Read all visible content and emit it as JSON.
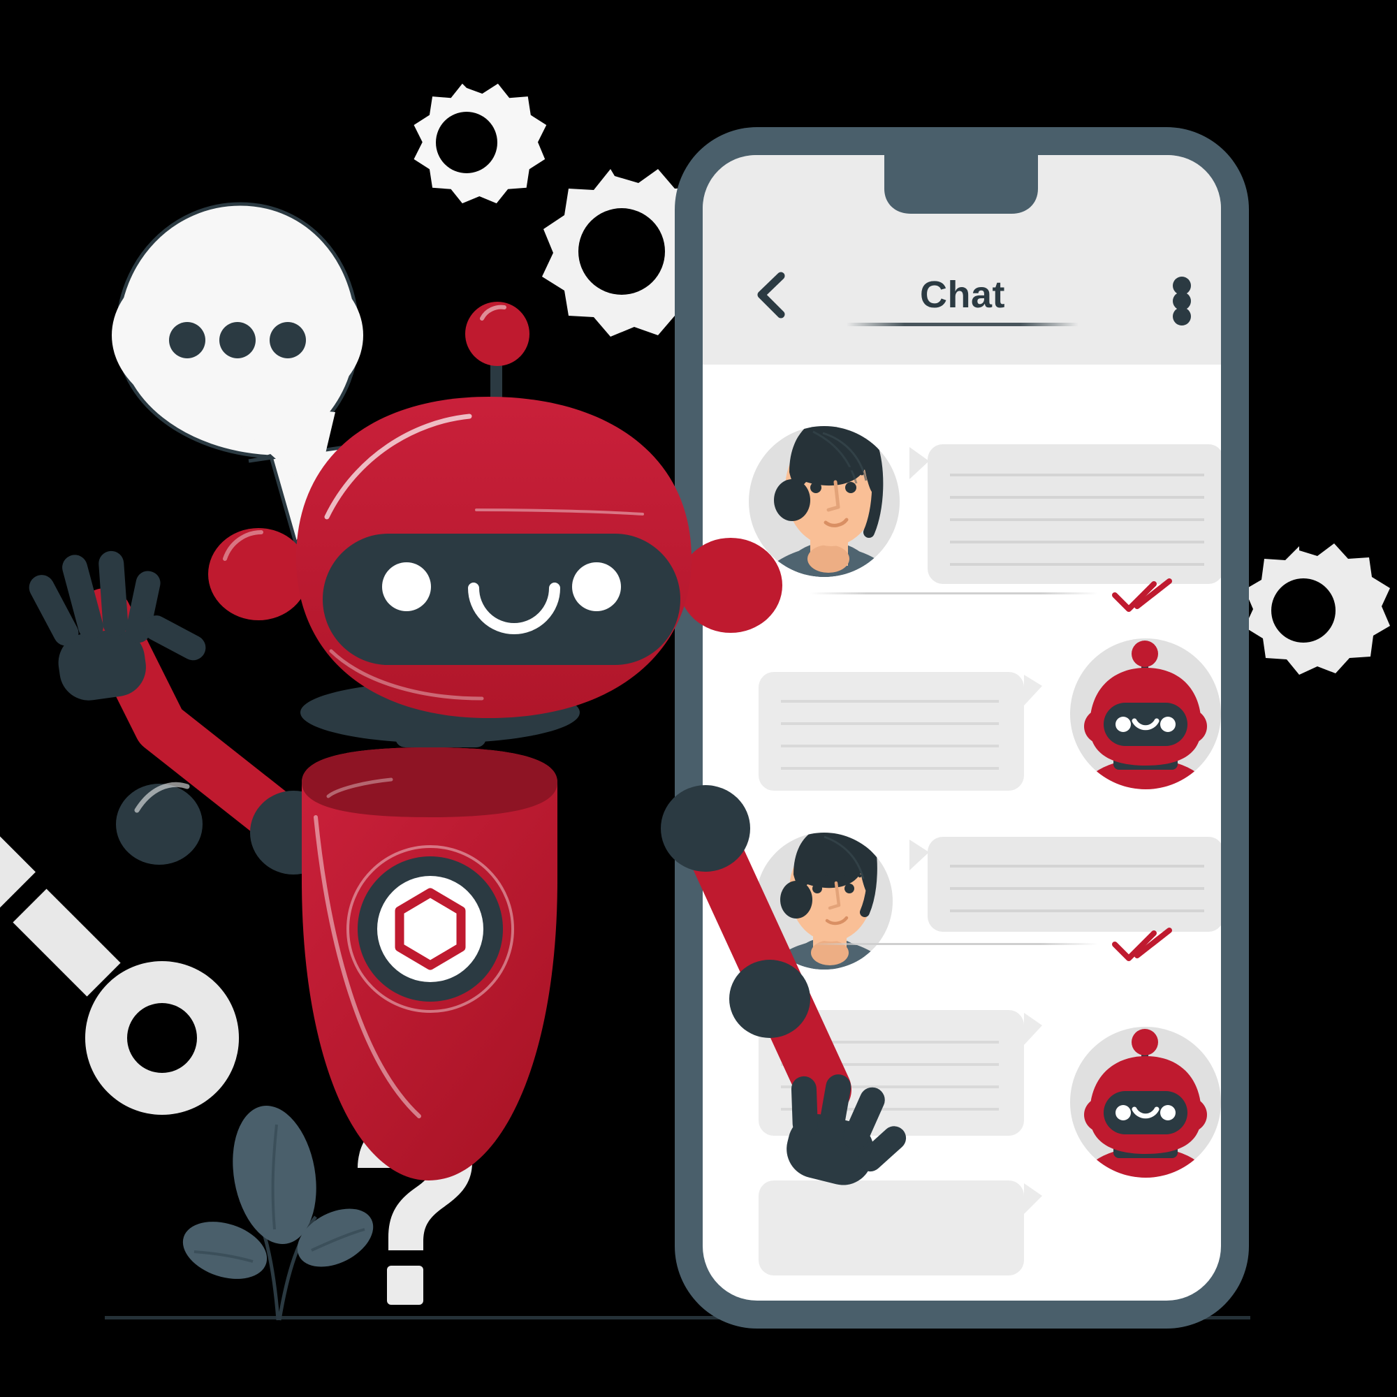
{
  "scene": {
    "title": "Chatbot illustration",
    "background_color": "#000000",
    "palette": {
      "red": "#bf1a2f",
      "red_dark": "#8e1424",
      "red_light": "#c9203a",
      "slate": "#2b3a42",
      "slate_mid": "#4a5f6b",
      "grey_light": "#ebebeb",
      "grey_bubble": "#e8e8e8",
      "grey_line": "#dddddd",
      "white": "#ffffff",
      "off_white": "#f7f7f7",
      "skin": "#f9bf96",
      "hair": "#263238",
      "shirt": "#4f6470",
      "accent_check": "#bf1a2f"
    }
  },
  "phone": {
    "frame_color": "#4a5f6b",
    "screen_color": "#ffffff",
    "header": {
      "background": "#ebebeb",
      "back_icon": "chevron-left-icon",
      "title": "Chat",
      "menu_icon": "kebab-menu-icon"
    },
    "messages": [
      {
        "id": "msg-1",
        "side": "left",
        "sender": "user",
        "avatar": "woman-avatar",
        "bubble_lines": 6,
        "receipt": "double-check",
        "receipt_color": "#bf1a2f"
      },
      {
        "id": "msg-2",
        "side": "right",
        "sender": "bot",
        "avatar": "robot-avatar",
        "bubble_lines": 4,
        "receipt": "none",
        "receipt_color": ""
      },
      {
        "id": "msg-3",
        "side": "left",
        "sender": "user",
        "avatar": "woman-avatar",
        "bubble_lines": 3,
        "receipt": "double-check",
        "receipt_color": "#bf1a2f"
      },
      {
        "id": "msg-4",
        "side": "right",
        "sender": "bot",
        "avatar": "robot-avatar",
        "bubble_lines": 4,
        "receipt": "none",
        "receipt_color": ""
      },
      {
        "id": "msg-5",
        "side": "right",
        "sender": "bot",
        "avatar": "none",
        "bubble_lines": 1,
        "receipt": "none",
        "receipt_color": ""
      }
    ]
  },
  "robot": {
    "name": "main-robot",
    "body_color": "#bf1a2f",
    "visor_color": "#2b3a42",
    "eye_color": "#ffffff",
    "antenna_ball_color": "#bf1a2f",
    "emblem": {
      "ring_color": "#2b3a42",
      "center_color": "#ffffff",
      "hexagon_color": "#bf1a2f"
    },
    "hand_color": "#2b3a42"
  },
  "decorations": [
    {
      "name": "speech-bubble-typing",
      "dots": 3,
      "color": "#f7f7f7",
      "dot_color": "#2b3a42"
    },
    {
      "name": "gear-large-top",
      "color": "#f2f2f2"
    },
    {
      "name": "gear-small-top",
      "color": "#f7f7f7"
    },
    {
      "name": "gear-right",
      "color": "#ececec"
    },
    {
      "name": "magnifier-icon",
      "color": "#e8e8e8"
    },
    {
      "name": "question-mark-icon",
      "color": "#ebebeb"
    },
    {
      "name": "plant-sprig",
      "color": "#4a5f6b"
    },
    {
      "name": "ground-shadow",
      "color": "#2b3a42"
    }
  ]
}
